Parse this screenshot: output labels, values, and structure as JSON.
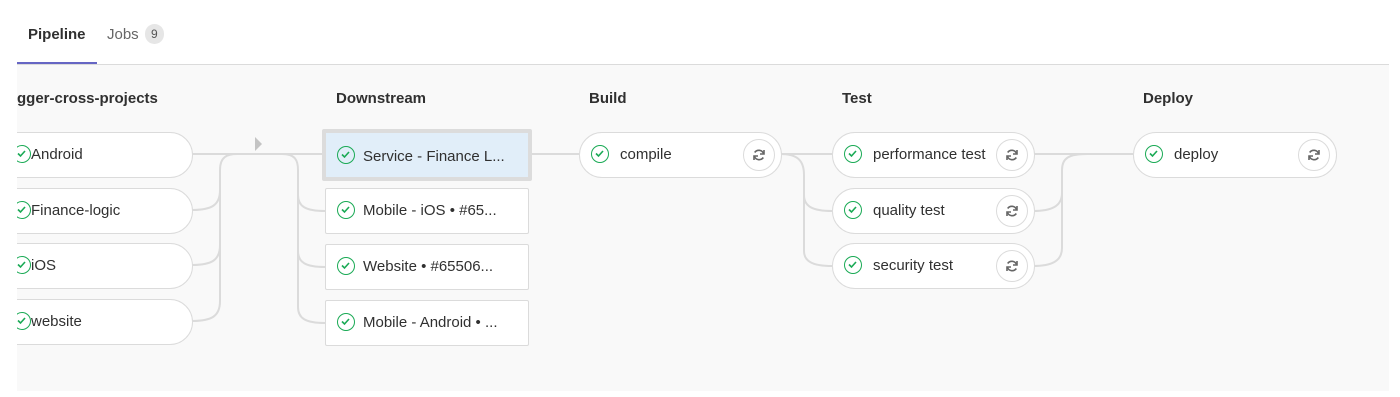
{
  "tabs": {
    "pipeline": "Pipeline",
    "jobs": "Jobs",
    "jobs_count": "9"
  },
  "stages": {
    "upstream": {
      "title": "trigger-cross-projects",
      "jobs": [
        "Android",
        "Finance-logic",
        "iOS",
        "website"
      ]
    },
    "downstream": {
      "title": "Downstream",
      "jobs": [
        "Service - Finance L...",
        "Mobile - iOS • #65...",
        "Website • #65506...",
        "Mobile - Android • ..."
      ]
    },
    "build": {
      "title": "Build",
      "jobs": [
        "compile"
      ]
    },
    "test": {
      "title": "Test",
      "jobs": [
        "performance test",
        "quality test",
        "security test"
      ]
    },
    "deploy": {
      "title": "Deploy",
      "jobs": [
        "deploy"
      ]
    }
  },
  "colors": {
    "success": "#1aaa55",
    "active_tab_underline": "#6666c4",
    "active_job_bg": "#e1eef9"
  },
  "icons": {
    "status": "status-success-icon",
    "retry": "retry-icon",
    "expand": "expand-arrow-icon"
  }
}
